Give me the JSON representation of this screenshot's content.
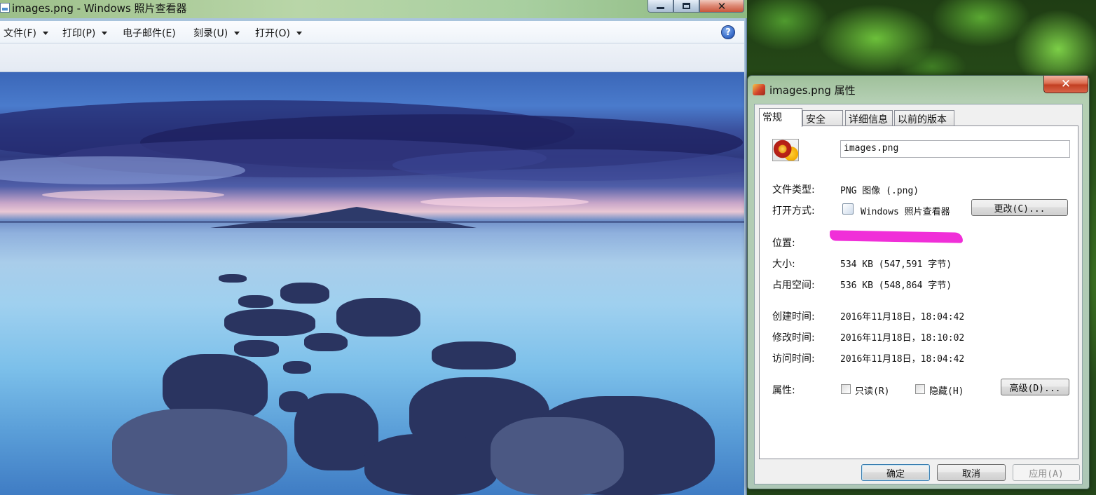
{
  "viewer": {
    "title": "images.png - Windows 照片查看器",
    "menu": {
      "file": "文件(F)",
      "print": "打印(P)",
      "email": "电子邮件(E)",
      "burn": "刻录(U)",
      "open": "打开(O)"
    },
    "help_glyph": "?",
    "caption_close_glyph": "✕"
  },
  "dialog": {
    "title": "images.png 属性",
    "close_glyph": "✕",
    "tabs": [
      "常规",
      "安全",
      "详细信息",
      "以前的版本"
    ],
    "active_tab": "常规",
    "filename": "images.png",
    "type_label": "文件类型:",
    "type_value": "PNG 图像 (.png)",
    "opens_with_label": "打开方式:",
    "opens_with_value": "Windows 照片查看器",
    "change_button": "更改(C)...",
    "location_label": "位置:",
    "size_label": "大小:",
    "size_value": "534 KB (547,591 字节)",
    "size_on_disk_label": "占用空间:",
    "size_on_disk_value": "536 KB (548,864 字节)",
    "created_label": "创建时间:",
    "created_value": "2016年11月18日，18:04:42",
    "modified_label": "修改时间:",
    "modified_value": "2016年11月18日，18:10:02",
    "accessed_label": "访问时间:",
    "accessed_value": "2016年11月18日，18:04:42",
    "attributes_label": "属性:",
    "readonly_label": "只读(R)",
    "readonly_checked": false,
    "hidden_label": "隐藏(H)",
    "hidden_checked": false,
    "advanced_button": "高级(D)...",
    "ok_button": "确定",
    "cancel_button": "取消",
    "apply_button": "应用(A)"
  },
  "colors": {
    "redaction": "#f02fd8",
    "default_button_border": "#3c7fb1"
  }
}
